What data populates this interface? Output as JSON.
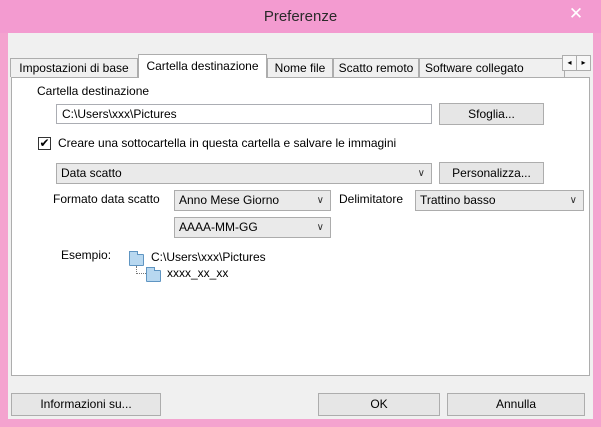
{
  "window": {
    "title": "Preferenze",
    "close_symbol": "✕"
  },
  "tabs": [
    {
      "label": "Impostazioni di base",
      "active": false
    },
    {
      "label": "Cartella destinazione",
      "active": true
    },
    {
      "label": "Nome file",
      "active": false
    },
    {
      "label": "Scatto remoto",
      "active": false
    },
    {
      "label": "Software collegato",
      "active": false
    }
  ],
  "tab_scroll": {
    "left": "◂",
    "right": "▸"
  },
  "destination": {
    "section_label": "Cartella destinazione",
    "path": "C:\\Users\\xxx\\Pictures",
    "browse_button": "Sfoglia..."
  },
  "subfolder": {
    "checked": true,
    "check_mark": "✔",
    "label": "Creare una sottocartella in questa cartella e salvare le immagini",
    "mode": "Data scatto",
    "customize_button": "Personalizza...",
    "date_format_label": "Formato data scatto",
    "date_format_value": "Anno Mese Giorno",
    "delimiter_label": "Delimitatore",
    "delimiter_value": "Trattino basso",
    "pattern_value": "AAAA-MM-GG"
  },
  "example": {
    "label": "Esempio:",
    "root": "C:\\Users\\xxx\\Pictures",
    "child": "xxxx_xx_xx"
  },
  "footer": {
    "info_button": "Informazioni su...",
    "ok_button": "OK",
    "cancel_button": "Annulla"
  },
  "colors": {
    "titlebar": "#f39bd0",
    "panel": "#ffffff",
    "dialog": "#f0f0f0"
  },
  "icons": {
    "dropdown": "chevron-down-icon",
    "folder": "folder-icon",
    "close": "close-icon"
  }
}
